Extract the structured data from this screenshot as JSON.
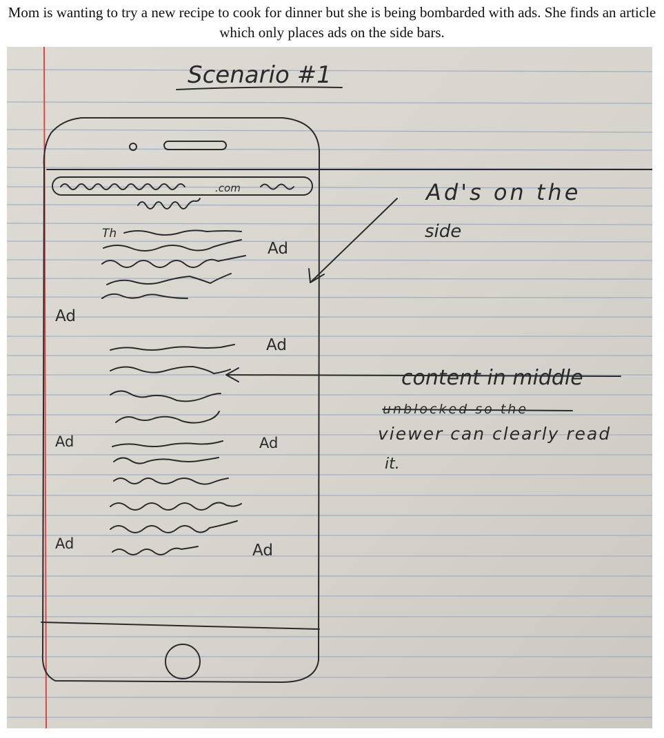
{
  "caption": "Mom is wanting to try a new recipe to cook for dinner but she is being bombarded with ads. She finds an article which only places ads on the side bars.",
  "sketch": {
    "title": "Scenario #1",
    "url_fragment": ".com",
    "article_start": "Th",
    "ad_label": "Ad",
    "annotation_ads_line1": "Ad's on the",
    "annotation_ads_line2": "side",
    "annotation_content_line1": "content in middle",
    "annotation_content_line2": "unblocked so the",
    "annotation_content_line3": "viewer can clearly read",
    "annotation_content_line4": "it.",
    "colors": {
      "paper": "#d9d6cf",
      "rule_line": "#8aa0bf",
      "margin_line": "#d64848",
      "ink": "#2a2a2a"
    }
  }
}
